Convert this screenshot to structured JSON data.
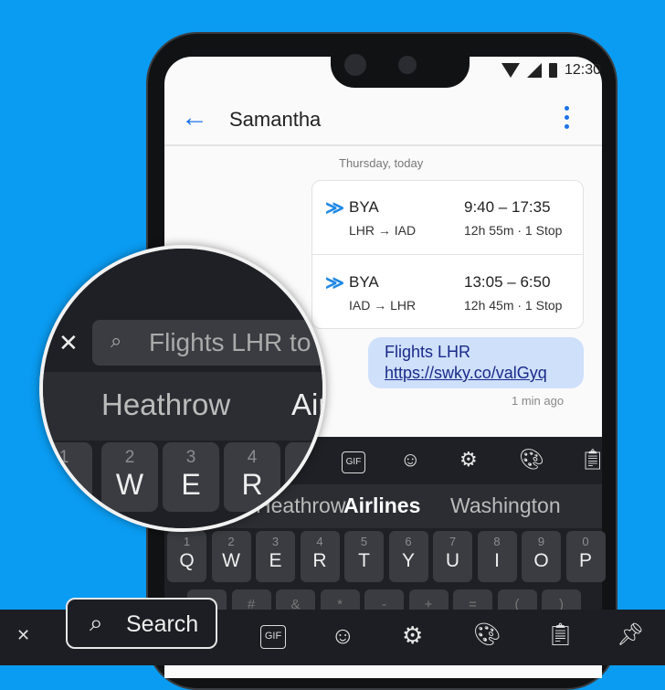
{
  "status": {
    "time": "12:30"
  },
  "header": {
    "contact": "Samantha"
  },
  "conversation": {
    "date_label": "Thursday, today",
    "flights": [
      {
        "airline": "BYA",
        "route_from": "LHR",
        "route_to": "IAD",
        "times": "9:40 – 17:35",
        "details": "12h 55m · 1 Stop"
      },
      {
        "airline": "BYA",
        "route_from": "IAD",
        "route_to": "LHR",
        "times": "13:05 – 6:50",
        "details": "12h 45m · 1 Stop"
      }
    ],
    "message": {
      "line1": "Flights LHR",
      "link": "https://swky.co/valGyq",
      "time": "1 min ago"
    }
  },
  "keyboard": {
    "toolbar": {
      "gif": "GIF"
    },
    "suggestions": [
      "Heathrow",
      "Airlines",
      "Washington"
    ],
    "row1": [
      {
        "n": "1",
        "l": "Q"
      },
      {
        "n": "2",
        "l": "W"
      },
      {
        "n": "3",
        "l": "E"
      },
      {
        "n": "4",
        "l": "R"
      },
      {
        "n": "5",
        "l": "T"
      },
      {
        "n": "6",
        "l": "Y"
      },
      {
        "n": "7",
        "l": "U"
      },
      {
        "n": "8",
        "l": "I"
      },
      {
        "n": "9",
        "l": "O"
      },
      {
        "n": "0",
        "l": "P"
      }
    ],
    "row2": [
      "@",
      "#",
      "&",
      "*",
      "-",
      "+",
      "=",
      "(",
      ")"
    ]
  },
  "magnifier": {
    "search_value": "Flights LHR to",
    "suggestions": [
      "Heathrow",
      "Air"
    ]
  },
  "bottom_bar": {
    "search_label": "Search",
    "gif": "GIF"
  },
  "colors": {
    "background": "#0a9cf2",
    "accent": "#1a73e8",
    "bubble": "#cfe0fb",
    "keyboard": "#2b2d32"
  }
}
